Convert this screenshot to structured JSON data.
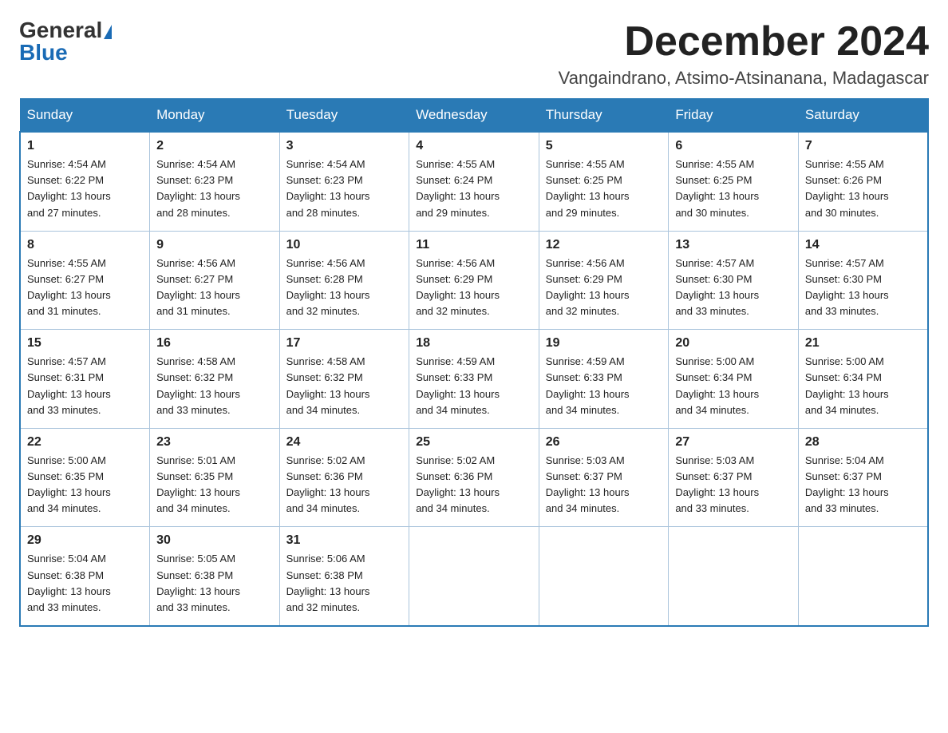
{
  "logo": {
    "general": "General",
    "blue": "Blue"
  },
  "title": "December 2024",
  "location": "Vangaindrano, Atsimo-Atsinanana, Madagascar",
  "days_of_week": [
    "Sunday",
    "Monday",
    "Tuesday",
    "Wednesday",
    "Thursday",
    "Friday",
    "Saturday"
  ],
  "weeks": [
    [
      {
        "day": "1",
        "info": "Sunrise: 4:54 AM\nSunset: 6:22 PM\nDaylight: 13 hours\nand 27 minutes."
      },
      {
        "day": "2",
        "info": "Sunrise: 4:54 AM\nSunset: 6:23 PM\nDaylight: 13 hours\nand 28 minutes."
      },
      {
        "day": "3",
        "info": "Sunrise: 4:54 AM\nSunset: 6:23 PM\nDaylight: 13 hours\nand 28 minutes."
      },
      {
        "day": "4",
        "info": "Sunrise: 4:55 AM\nSunset: 6:24 PM\nDaylight: 13 hours\nand 29 minutes."
      },
      {
        "day": "5",
        "info": "Sunrise: 4:55 AM\nSunset: 6:25 PM\nDaylight: 13 hours\nand 29 minutes."
      },
      {
        "day": "6",
        "info": "Sunrise: 4:55 AM\nSunset: 6:25 PM\nDaylight: 13 hours\nand 30 minutes."
      },
      {
        "day": "7",
        "info": "Sunrise: 4:55 AM\nSunset: 6:26 PM\nDaylight: 13 hours\nand 30 minutes."
      }
    ],
    [
      {
        "day": "8",
        "info": "Sunrise: 4:55 AM\nSunset: 6:27 PM\nDaylight: 13 hours\nand 31 minutes."
      },
      {
        "day": "9",
        "info": "Sunrise: 4:56 AM\nSunset: 6:27 PM\nDaylight: 13 hours\nand 31 minutes."
      },
      {
        "day": "10",
        "info": "Sunrise: 4:56 AM\nSunset: 6:28 PM\nDaylight: 13 hours\nand 32 minutes."
      },
      {
        "day": "11",
        "info": "Sunrise: 4:56 AM\nSunset: 6:29 PM\nDaylight: 13 hours\nand 32 minutes."
      },
      {
        "day": "12",
        "info": "Sunrise: 4:56 AM\nSunset: 6:29 PM\nDaylight: 13 hours\nand 32 minutes."
      },
      {
        "day": "13",
        "info": "Sunrise: 4:57 AM\nSunset: 6:30 PM\nDaylight: 13 hours\nand 33 minutes."
      },
      {
        "day": "14",
        "info": "Sunrise: 4:57 AM\nSunset: 6:30 PM\nDaylight: 13 hours\nand 33 minutes."
      }
    ],
    [
      {
        "day": "15",
        "info": "Sunrise: 4:57 AM\nSunset: 6:31 PM\nDaylight: 13 hours\nand 33 minutes."
      },
      {
        "day": "16",
        "info": "Sunrise: 4:58 AM\nSunset: 6:32 PM\nDaylight: 13 hours\nand 33 minutes."
      },
      {
        "day": "17",
        "info": "Sunrise: 4:58 AM\nSunset: 6:32 PM\nDaylight: 13 hours\nand 34 minutes."
      },
      {
        "day": "18",
        "info": "Sunrise: 4:59 AM\nSunset: 6:33 PM\nDaylight: 13 hours\nand 34 minutes."
      },
      {
        "day": "19",
        "info": "Sunrise: 4:59 AM\nSunset: 6:33 PM\nDaylight: 13 hours\nand 34 minutes."
      },
      {
        "day": "20",
        "info": "Sunrise: 5:00 AM\nSunset: 6:34 PM\nDaylight: 13 hours\nand 34 minutes."
      },
      {
        "day": "21",
        "info": "Sunrise: 5:00 AM\nSunset: 6:34 PM\nDaylight: 13 hours\nand 34 minutes."
      }
    ],
    [
      {
        "day": "22",
        "info": "Sunrise: 5:00 AM\nSunset: 6:35 PM\nDaylight: 13 hours\nand 34 minutes."
      },
      {
        "day": "23",
        "info": "Sunrise: 5:01 AM\nSunset: 6:35 PM\nDaylight: 13 hours\nand 34 minutes."
      },
      {
        "day": "24",
        "info": "Sunrise: 5:02 AM\nSunset: 6:36 PM\nDaylight: 13 hours\nand 34 minutes."
      },
      {
        "day": "25",
        "info": "Sunrise: 5:02 AM\nSunset: 6:36 PM\nDaylight: 13 hours\nand 34 minutes."
      },
      {
        "day": "26",
        "info": "Sunrise: 5:03 AM\nSunset: 6:37 PM\nDaylight: 13 hours\nand 34 minutes."
      },
      {
        "day": "27",
        "info": "Sunrise: 5:03 AM\nSunset: 6:37 PM\nDaylight: 13 hours\nand 33 minutes."
      },
      {
        "day": "28",
        "info": "Sunrise: 5:04 AM\nSunset: 6:37 PM\nDaylight: 13 hours\nand 33 minutes."
      }
    ],
    [
      {
        "day": "29",
        "info": "Sunrise: 5:04 AM\nSunset: 6:38 PM\nDaylight: 13 hours\nand 33 minutes."
      },
      {
        "day": "30",
        "info": "Sunrise: 5:05 AM\nSunset: 6:38 PM\nDaylight: 13 hours\nand 33 minutes."
      },
      {
        "day": "31",
        "info": "Sunrise: 5:06 AM\nSunset: 6:38 PM\nDaylight: 13 hours\nand 32 minutes."
      },
      {
        "day": "",
        "info": ""
      },
      {
        "day": "",
        "info": ""
      },
      {
        "day": "",
        "info": ""
      },
      {
        "day": "",
        "info": ""
      }
    ]
  ]
}
